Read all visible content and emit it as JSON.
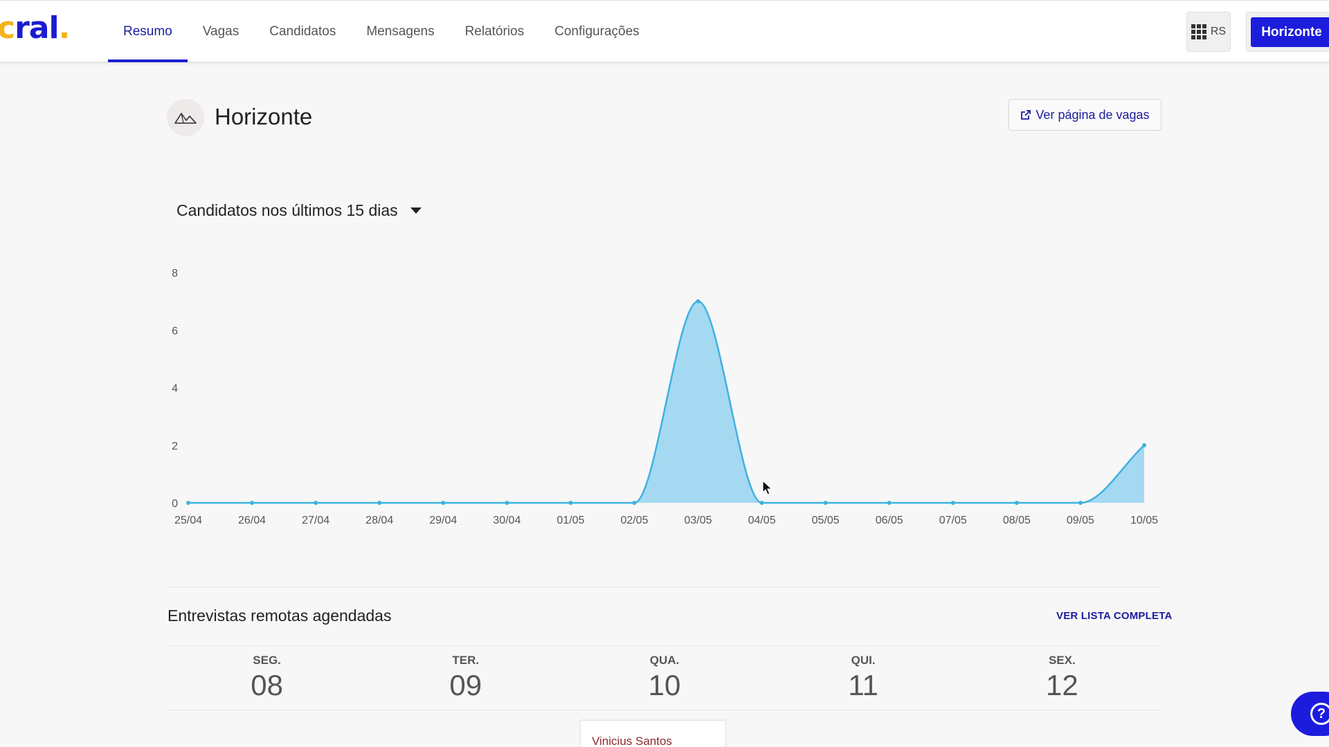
{
  "brand": {
    "logo_main": "ral",
    "logo_dot": ".",
    "logo_prefix": "c"
  },
  "nav": [
    {
      "label": "Resumo",
      "active": true
    },
    {
      "label": "Vagas"
    },
    {
      "label": "Candidatos"
    },
    {
      "label": "Mensagens"
    },
    {
      "label": "Relatórios"
    },
    {
      "label": "Configurações"
    }
  ],
  "topbar": {
    "apps_label": "RS",
    "company_label": "Horizonte"
  },
  "header": {
    "title": "Horizonte",
    "jobs_page_button": "Ver página de vagas"
  },
  "chart_section": {
    "heading": "Candidatos nos últimos 15 dias"
  },
  "chart_data": {
    "type": "area",
    "x": [
      "25/04",
      "26/04",
      "27/04",
      "28/04",
      "29/04",
      "30/04",
      "01/05",
      "02/05",
      "03/05",
      "04/05",
      "05/05",
      "06/05",
      "07/05",
      "08/05",
      "09/05",
      "10/05"
    ],
    "series": [
      {
        "values": [
          0,
          0,
          0,
          0,
          0,
          0,
          0,
          0,
          7,
          0,
          0,
          0,
          0,
          0,
          0,
          2
        ]
      }
    ],
    "yticks": [
      0,
      2,
      4,
      6,
      8
    ],
    "ylim": [
      0,
      8
    ],
    "color": "#3eb1e0",
    "fill": "#a5d9f1"
  },
  "interviews": {
    "title": "Entrevistas remotas agendadas",
    "full_list_link": "VER LISTA COMPLETA",
    "days": [
      {
        "dow": "SEG.",
        "num": "08"
      },
      {
        "dow": "TER.",
        "num": "09"
      },
      {
        "dow": "QUA.",
        "num": "10"
      },
      {
        "dow": "QUI.",
        "num": "11"
      },
      {
        "dow": "SEX.",
        "num": "12"
      }
    ],
    "card_name": "Vinicius Santos"
  },
  "icons": {
    "apps": "grid-icon",
    "avatar": "mountain-icon",
    "external": "external-link-icon",
    "dropdown": "caret-down-icon",
    "help": "help-icon"
  }
}
